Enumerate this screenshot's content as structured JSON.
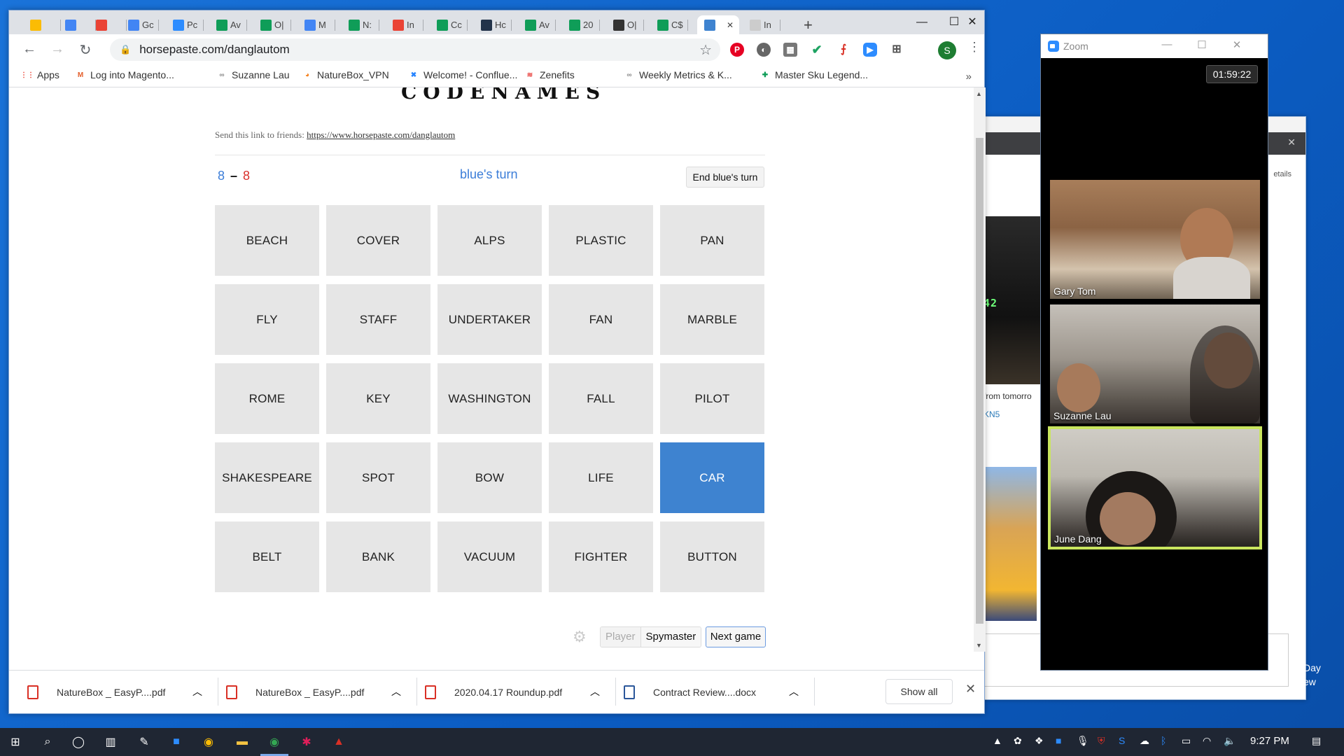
{
  "browser": {
    "tabs": [
      {
        "label": "",
        "fav": "drive-icon",
        "color": "#fbbc04"
      },
      {
        "label": "",
        "fav": "calendar-icon",
        "color": "#4285f4"
      },
      {
        "label": "",
        "fav": "gmail-icon",
        "color": "#ea4335"
      },
      {
        "label": "Gc",
        "fav": "calendar-icon",
        "color": "#4285f4"
      },
      {
        "label": "Pc",
        "fav": "zoom-icon",
        "color": "#2d8cff"
      },
      {
        "label": "Av",
        "fav": "sheets-icon",
        "color": "#0f9d58"
      },
      {
        "label": "O|",
        "fav": "sheets-icon",
        "color": "#0f9d58"
      },
      {
        "label": "M",
        "fav": "docs-icon",
        "color": "#4285f4"
      },
      {
        "label": "N:",
        "fav": "sheets-icon",
        "color": "#0f9d58"
      },
      {
        "label": "In",
        "fav": "gmail-icon",
        "color": "#ea4335"
      },
      {
        "label": "Cc",
        "fav": "sheets-icon",
        "color": "#0f9d58"
      },
      {
        "label": "Hc",
        "fav": "sh-icon",
        "color": "#22334a"
      },
      {
        "label": "Av",
        "fav": "sheets-icon",
        "color": "#0f9d58"
      },
      {
        "label": "20",
        "fav": "sheets-icon",
        "color": "#0f9d58"
      },
      {
        "label": "O|",
        "fav": "trello-icon",
        "color": "#333333"
      },
      {
        "label": "C$",
        "fav": "sheets-icon",
        "color": "#0f9d58"
      },
      {
        "label": "",
        "fav": "page-icon",
        "color": "#3e83d0"
      },
      {
        "label": "In",
        "fav": "mail-icon",
        "color": "#cccccc"
      }
    ],
    "url": "horsepaste.com/danglautom",
    "bookmarks": [
      {
        "label": "Apps",
        "icon": "apps-icon"
      },
      {
        "label": "Log into Magento...",
        "icon": "magento-icon"
      },
      {
        "label": "Suzanne Lau",
        "icon": "link-icon"
      },
      {
        "label": "NatureBox_VPN",
        "icon": "vpn-icon"
      },
      {
        "label": "Welcome! - Conflue...",
        "icon": "confluence-icon"
      },
      {
        "label": "Zenefits",
        "icon": "zenefits-icon"
      },
      {
        "label": "Weekly Metrics & K...",
        "icon": "link-icon"
      },
      {
        "label": "Master Sku Legend...",
        "icon": "sheets-icon"
      }
    ],
    "profile_initial": "S"
  },
  "game": {
    "title": "CODENAMES",
    "share_prefix": "Send this link to friends:",
    "share_link": "https://www.horsepaste.com/danglautom",
    "score_blue": "8",
    "score_dash": "–",
    "score_red": "8",
    "turn": "blue's turn",
    "end_turn_label": "End blue's turn",
    "cards": [
      {
        "word": "BEACH",
        "state": "hidden"
      },
      {
        "word": "COVER",
        "state": "hidden"
      },
      {
        "word": "ALPS",
        "state": "hidden"
      },
      {
        "word": "PLASTIC",
        "state": "hidden"
      },
      {
        "word": "PAN",
        "state": "hidden"
      },
      {
        "word": "FLY",
        "state": "hidden"
      },
      {
        "word": "STAFF",
        "state": "hidden"
      },
      {
        "word": "UNDERTAKER",
        "state": "hidden"
      },
      {
        "word": "FAN",
        "state": "hidden"
      },
      {
        "word": "MARBLE",
        "state": "hidden"
      },
      {
        "word": "ROME",
        "state": "hidden"
      },
      {
        "word": "KEY",
        "state": "hidden"
      },
      {
        "word": "WASHINGTON",
        "state": "hidden"
      },
      {
        "word": "FALL",
        "state": "hidden"
      },
      {
        "word": "PILOT",
        "state": "hidden"
      },
      {
        "word": "SHAKESPEARE",
        "state": "hidden"
      },
      {
        "word": "SPOT",
        "state": "hidden"
      },
      {
        "word": "BOW",
        "state": "hidden"
      },
      {
        "word": "LIFE",
        "state": "hidden"
      },
      {
        "word": "CAR",
        "state": "blue"
      },
      {
        "word": "BELT",
        "state": "hidden"
      },
      {
        "word": "BANK",
        "state": "hidden"
      },
      {
        "word": "VACUUM",
        "state": "hidden"
      },
      {
        "word": "FIGHTER",
        "state": "hidden"
      },
      {
        "word": "BUTTON",
        "state": "hidden"
      }
    ],
    "mode_player": "Player",
    "mode_spymaster": "Spymaster",
    "next_game": "Next game"
  },
  "downloads": {
    "items": [
      {
        "name": "NatureBox _ EasyP....pdf",
        "type": "pdf"
      },
      {
        "name": "NatureBox _ EasyP....pdf",
        "type": "pdf"
      },
      {
        "name": "2020.04.17 Roundup.pdf",
        "type": "pdf"
      },
      {
        "name": "Contract Review....docx",
        "type": "docx"
      }
    ],
    "show_all": "Show all"
  },
  "zoom": {
    "title": "Zoom",
    "timer": "01:59:22",
    "participants": [
      "Gary Tom",
      "Suzanne Lau",
      "June Dang"
    ],
    "active_speaker": "June Dang"
  },
  "behind_window": {
    "details": "etails",
    "snippet": "from tomorro",
    "link_snippet": "KN5",
    "display": "42"
  },
  "desktop": {
    "right_text_1": "Day",
    "right_text_2": "ew"
  },
  "taskbar": {
    "time": "9:27 PM"
  }
}
